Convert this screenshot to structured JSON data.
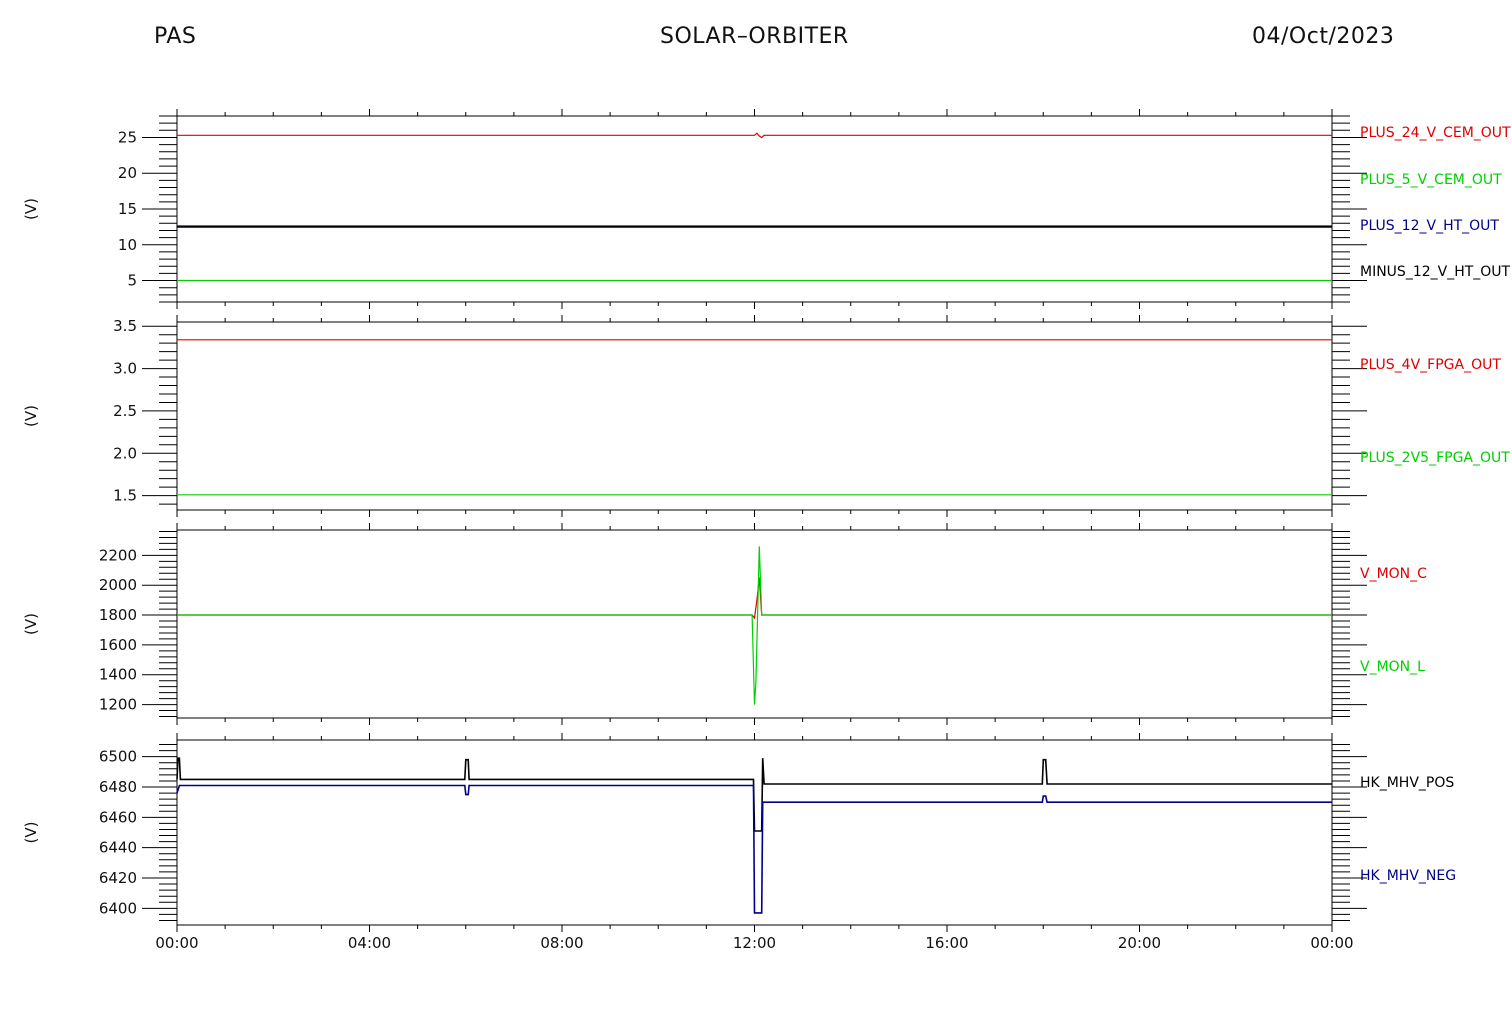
{
  "header": {
    "left": "PAS",
    "center": "SOLAR–ORBITER",
    "right": "04/Oct/2023"
  },
  "colors": {
    "red": "#e00000",
    "green": "#00d000",
    "blue": "#00008b",
    "black": "#000000"
  },
  "x_axis": {
    "range_hours": [
      0,
      24
    ],
    "tick_labels": [
      "00:00",
      "04:00",
      "08:00",
      "12:00",
      "16:00",
      "20:00",
      "00:00"
    ]
  },
  "chart_data": [
    {
      "type": "line",
      "ylabel": "(V)",
      "ylim": [
        2,
        28
      ],
      "yticks": [
        5,
        10,
        15,
        20,
        25
      ],
      "series": [
        {
          "name": "PLUS_24_V_CEM_OUT",
          "color": "red",
          "x": [
            0,
            12.0,
            12.05,
            12.1,
            12.15,
            12.2,
            24
          ],
          "y": [
            25.3,
            25.3,
            25.6,
            25.2,
            25.0,
            25.3,
            25.3
          ]
        },
        {
          "name": "PLUS_5_V_CEM_OUT",
          "color": "green",
          "x": [
            0,
            24
          ],
          "y": [
            5.0,
            5.0
          ]
        },
        {
          "name": "PLUS_12_V_HT_OUT",
          "color": "blue",
          "x": [
            0,
            24
          ],
          "y": [
            12.6,
            12.6
          ]
        },
        {
          "name": "MINUS_12_V_HT_OUT",
          "color": "black",
          "x": [
            0,
            24
          ],
          "y": [
            12.5,
            12.5
          ]
        }
      ]
    },
    {
      "type": "line",
      "ylabel": "(V)",
      "ylim": [
        1.33,
        3.55
      ],
      "yticks": [
        1.5,
        2.0,
        2.5,
        3.0,
        3.5
      ],
      "series": [
        {
          "name": "PLUS_4V_FPGA_OUT",
          "color": "red",
          "x": [
            0,
            24
          ],
          "y": [
            3.34,
            3.34
          ]
        },
        {
          "name": "PLUS_2V5_FPGA_OUT",
          "color": "green",
          "x": [
            0,
            24
          ],
          "y": [
            1.51,
            1.51
          ]
        }
      ]
    },
    {
      "type": "line",
      "ylabel": "(V)",
      "ylim": [
        1110,
        2370
      ],
      "yticks": [
        1200,
        1400,
        1600,
        1800,
        2000,
        2200
      ],
      "series": [
        {
          "name": "V_MON_C",
          "color": "red",
          "x": [
            0,
            11.95,
            12.0,
            12.05,
            12.1,
            12.15,
            24
          ],
          "y": [
            1800,
            1800,
            1780,
            1900,
            2050,
            1800,
            1800
          ]
        },
        {
          "name": "V_MON_L",
          "color": "green",
          "x": [
            0,
            11.95,
            12.0,
            12.03,
            12.1,
            12.15,
            12.2,
            24
          ],
          "y": [
            1800,
            1800,
            1200,
            1350,
            2260,
            1800,
            1800,
            1800
          ]
        }
      ]
    },
    {
      "type": "line",
      "ylabel": "(V)",
      "ylim": [
        6389,
        6511
      ],
      "yticks": [
        6400,
        6420,
        6440,
        6460,
        6480,
        6500
      ],
      "series": [
        {
          "name": "HK_MHV_POS",
          "color": "black",
          "x": [
            0,
            0.02,
            0.05,
            0.07,
            5.98,
            6.0,
            6.05,
            6.07,
            11.98,
            12.0,
            12.02,
            12.15,
            12.17,
            12.2,
            17.98,
            18.0,
            18.05,
            18.08,
            24
          ],
          "y": [
            6485,
            6499,
            6499,
            6485,
            6485,
            6498,
            6498,
            6485,
            6485,
            6451,
            6451,
            6451,
            6499,
            6482,
            6482,
            6498,
            6498,
            6482,
            6482
          ]
        },
        {
          "name": "HK_MHV_NEG",
          "color": "blue",
          "x": [
            0,
            0.05,
            5.98,
            6.0,
            6.05,
            6.07,
            11.98,
            12.0,
            12.02,
            12.15,
            12.17,
            12.2,
            17.98,
            18.0,
            18.05,
            18.08,
            24
          ],
          "y": [
            6476,
            6481,
            6481,
            6475,
            6475,
            6481,
            6481,
            6397,
            6397,
            6397,
            6470,
            6470,
            6470,
            6474,
            6474,
            6470,
            6470
          ]
        }
      ]
    }
  ]
}
